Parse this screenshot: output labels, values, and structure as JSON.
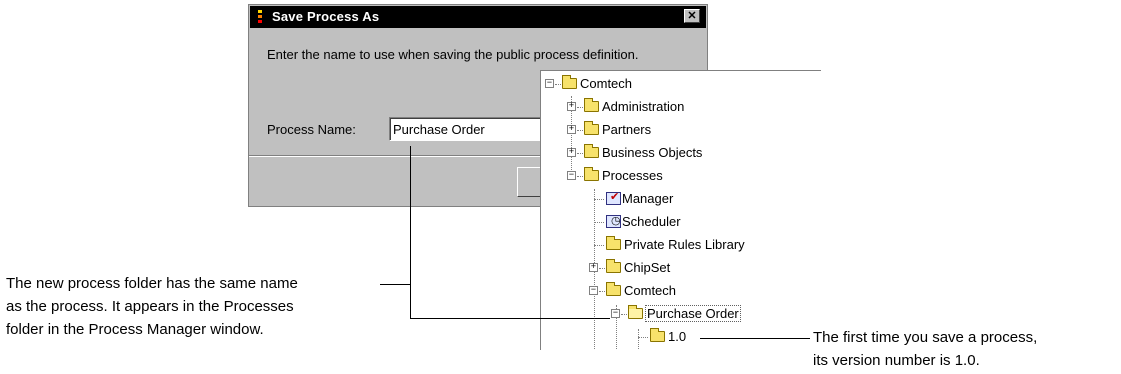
{
  "dialog": {
    "title": "Save Process As",
    "close_glyph": "✕",
    "prompt": "Enter the name to use when saving the public process definition.",
    "field_label": "Process Name:",
    "field_value": "Purchase Order"
  },
  "tree": {
    "nodes": [
      {
        "label": "Comtech",
        "expander": "−"
      },
      {
        "label": "Administration",
        "expander": "+"
      },
      {
        "label": "Partners",
        "expander": "+"
      },
      {
        "label": "Business Objects",
        "expander": "+"
      },
      {
        "label": "Processes",
        "expander": "−"
      },
      {
        "label": "Manager",
        "icon": "manager-icon"
      },
      {
        "label": "Scheduler",
        "icon": "scheduler-icon"
      },
      {
        "label": "Private Rules Library",
        "icon": "folder-icon"
      },
      {
        "label": "ChipSet",
        "expander": "+"
      },
      {
        "label": "Comtech",
        "expander": "−"
      },
      {
        "label": "Purchase Order",
        "expander": "−",
        "selected": true
      },
      {
        "label": "1.0",
        "icon": "folder-icon"
      }
    ]
  },
  "callouts": {
    "left": [
      "The new process folder has the same name",
      "as the process. It appears in the Processes",
      "folder in the Process Manager window."
    ],
    "right": [
      "The first time you save a process,",
      "its version number is 1.0."
    ]
  },
  "colors": {
    "title_bar": "#000000",
    "dialog_bg": "#c0c0c0",
    "folder": "#f7e26b"
  }
}
